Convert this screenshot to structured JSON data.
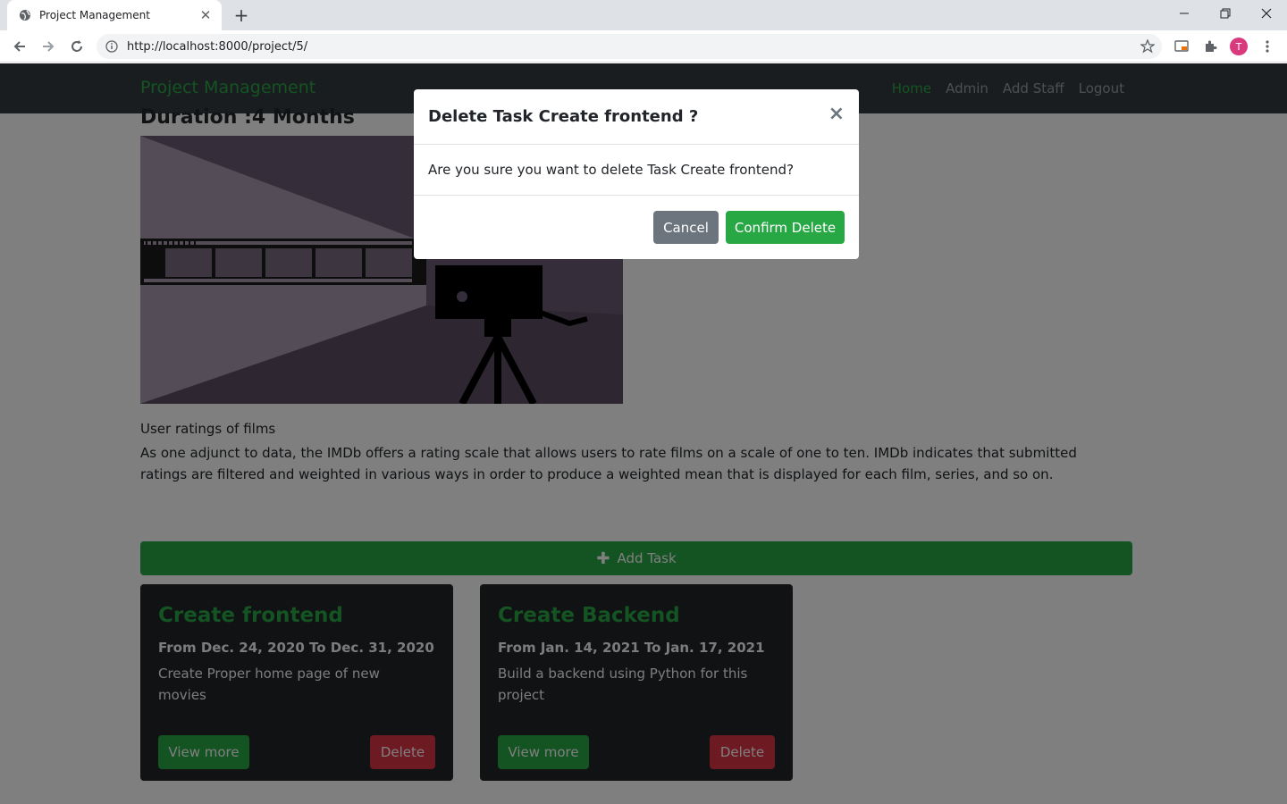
{
  "browser": {
    "tab_title": "Project Management",
    "url": "http://localhost:8000/project/5/",
    "profile_initial": "T"
  },
  "navbar": {
    "brand": "Project Management",
    "links": [
      "Home",
      "Admin",
      "Add Staff",
      "Logout"
    ],
    "active": "Home"
  },
  "project": {
    "duration": "Duration :4 Months",
    "ratings_title": "User ratings of films",
    "ratings_text": "As one adjunct to data, the IMDb offers a rating scale that allows users to rate films on a scale of one to ten. IMDb indicates that submitted ratings are filtered and weighted in various ways in order to produce a weighted mean that is displayed for each film, series, and so on."
  },
  "add_task_label": "Add Task",
  "tasks": [
    {
      "title": "Create frontend",
      "dates": "From Dec. 24, 2020 To Dec. 31, 2020",
      "description": "Create Proper home page of new movies",
      "view_label": "View more",
      "delete_label": "Delete"
    },
    {
      "title": "Create Backend",
      "dates": "From Jan. 14, 2021 To Jan. 17, 2021",
      "description": "Build a backend using Python for this project",
      "view_label": "View more",
      "delete_label": "Delete"
    }
  ],
  "modal": {
    "title": "Delete Task Create frontend ?",
    "close": "×",
    "body": "Are you sure you want to delete Task Create frontend?",
    "cancel_label": "Cancel",
    "confirm_label": "Confirm Delete"
  },
  "colors": {
    "accent": "#28a745",
    "danger": "#dc3545",
    "secondary": "#6c757d",
    "navbar": "#343a40",
    "card": "#212529"
  }
}
